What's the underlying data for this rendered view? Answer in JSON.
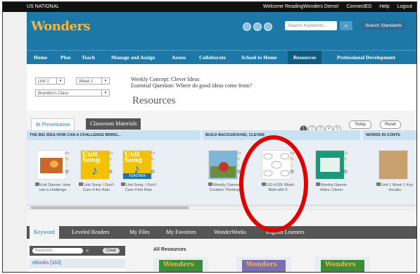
{
  "topbar": {
    "left": "US NATIONAL",
    "right": [
      "Welcome ReadingWonders Demo!",
      "ConnectED",
      "Help",
      "Logout"
    ]
  },
  "header": {
    "logo": "Wonders",
    "search_placeholder": "Search Keywords...",
    "search_standards": "Search Standards"
  },
  "nav": [
    "Home",
    "Plan",
    "Teach",
    "Manage and Assign",
    "Assess",
    "Collaborate",
    "School to Home",
    "Resources",
    "Professional Development"
  ],
  "nav_active": "Resources",
  "selectors": {
    "unit": "Unit 1",
    "week": "Week 1",
    "class": "Brandon's Class"
  },
  "concept": {
    "weekly": "Weekly Concept: Clever Ideas",
    "question": "Essential Question: Where do good ideas come from?",
    "title": "Resources"
  },
  "tabs_top": [
    "In Presentation",
    "Classroom Materials"
  ],
  "pager": [
    "1",
    "2",
    "3",
    "4",
    "5"
  ],
  "today": "Today",
  "reset": "Reset",
  "sections": [
    "THE BIG IDEA HOW CAN A CHALLENGE BRING...",
    "BUILD BACKGROUND, CLEVER",
    "WORDS IN CONTE"
  ],
  "cards": [
    "Unit Opener: How can a challenge",
    "Unit Song: I Don't Care if the Rain",
    "Unit Song: I Don't Care if the Rain",
    "Weekly Opener: Creative Thinking",
    "GO #139: Blank Web with 5",
    "Weekly Opener Video: Clever",
    "Unit 1 Week 1 Key Vocabu"
  ],
  "card_thumbs": {
    "song": "Unit Song",
    "teacher": "TEACHER"
  },
  "tabs_bottom": [
    "Keyword",
    "Leveled Readers",
    "My Files",
    "My Favorites",
    "WonderWorks",
    "English Learners"
  ],
  "keyword": {
    "placeholder": "Keyword...",
    "clear": "Clear",
    "ebooks": "eBooks [163]"
  },
  "all_resources": "All Resources",
  "resource_logo": "Wonders",
  "accent": "#1d78a8",
  "highlight_color": "#e10000"
}
